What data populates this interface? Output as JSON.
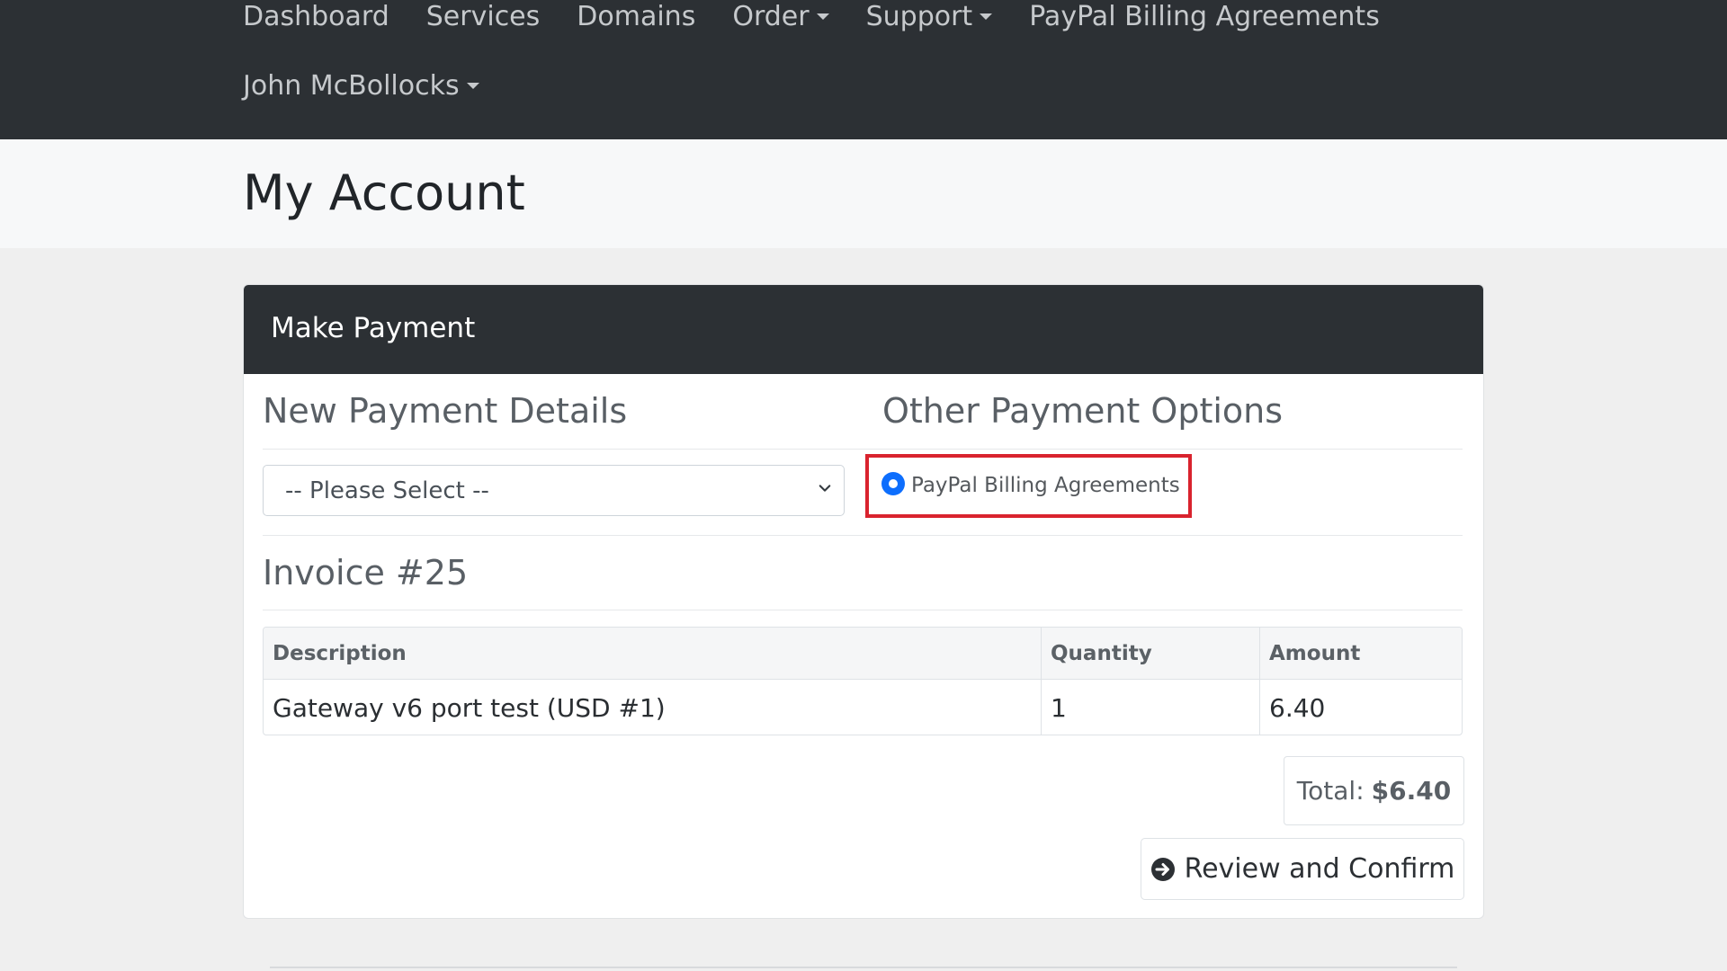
{
  "navbar": {
    "items": [
      {
        "label": "Dashboard",
        "dropdown": false
      },
      {
        "label": "Services",
        "dropdown": false
      },
      {
        "label": "Domains",
        "dropdown": false
      },
      {
        "label": "Order",
        "dropdown": true
      },
      {
        "label": "Support",
        "dropdown": true
      },
      {
        "label": "PayPal Billing Agreements",
        "dropdown": false
      }
    ],
    "user": {
      "label": "John McBollocks",
      "dropdown": true
    }
  },
  "page": {
    "title": "My Account"
  },
  "payment": {
    "header": "Make Payment",
    "new_details_heading": "New Payment Details",
    "select": {
      "value": "-- Please Select --"
    },
    "other_options_heading": "Other Payment Options",
    "radio": {
      "label": "PayPal Billing Agreements",
      "checked": true
    }
  },
  "invoice": {
    "heading": "Invoice #25",
    "columns": [
      "Description",
      "Quantity",
      "Amount"
    ],
    "rows": [
      {
        "description": "Gateway v6 port test (USD #1)",
        "quantity": "1",
        "amount": "6.40"
      }
    ],
    "total_label": "Total:",
    "total_value": "$6.40"
  },
  "actions": {
    "confirm_label": "Review and Confirm",
    "confirm_icon": "arrow-circle-right-icon"
  },
  "colors": {
    "navbar_bg": "#2c3034",
    "highlight": "#d9232e",
    "radio_accent": "#0d6efd",
    "page_bg": "#efefef"
  }
}
